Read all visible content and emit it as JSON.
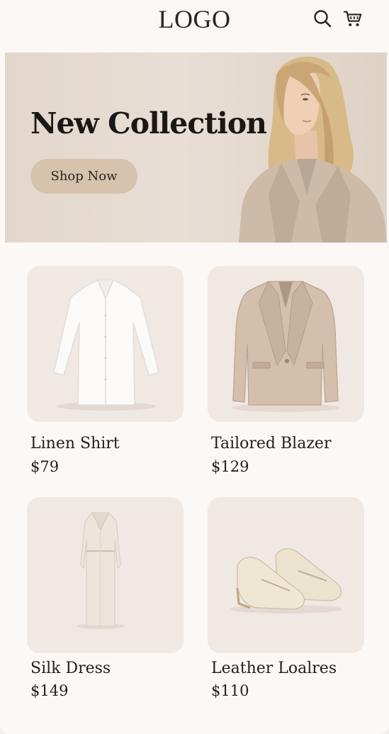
{
  "header": {
    "logo": "LOGO",
    "icons": [
      "search-icon",
      "cart-icon"
    ]
  },
  "hero": {
    "title": "New Collection",
    "cta_label": "Shop Now"
  },
  "products": [
    {
      "name": "Linen Shirt",
      "price": "$79",
      "image": "white-linen-shirt"
    },
    {
      "name": "Tailored Blazer",
      "price": "$129",
      "image": "beige-blazer"
    },
    {
      "name": "Silk Dress",
      "price": "$149",
      "image": "cream-dress"
    },
    {
      "name": "Leather Loalres",
      "price": "$110",
      "image": "cream-loafers"
    }
  ],
  "colors": {
    "background": "#fbf8f6",
    "hero_bg": "#e5dad0",
    "button": "#d6c2ad",
    "card_bg": "#f0e8e3",
    "text": "#1f1a17"
  }
}
